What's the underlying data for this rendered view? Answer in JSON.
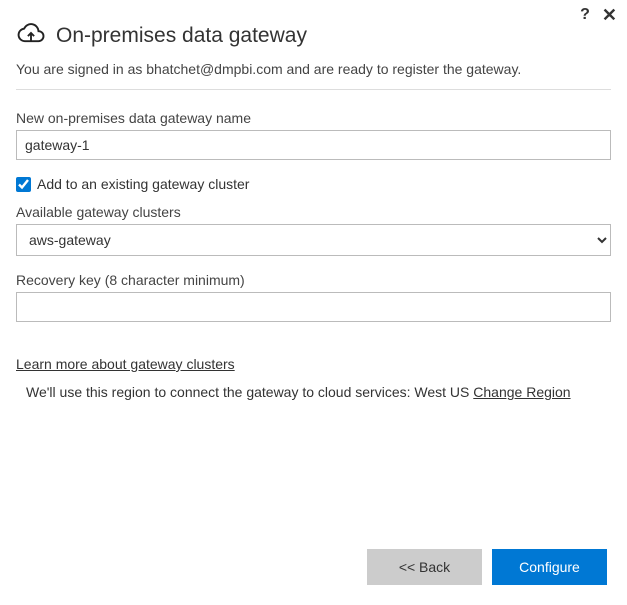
{
  "header": {
    "title": "On-premises data gateway",
    "subtitle_prefix": "You are signed in as ",
    "email": "bhatchet@dmpbi.com",
    "subtitle_suffix": " and are ready to register the gateway."
  },
  "form": {
    "gateway_name_label": "New on-premises data gateway name",
    "gateway_name_value": "gateway-1",
    "add_cluster_checkbox_label": "Add to an existing gateway cluster",
    "available_clusters_label": "Available gateway clusters",
    "available_clusters_value": "aws-gateway",
    "recovery_key_label": "Recovery key (8 character minimum)",
    "recovery_key_value": ""
  },
  "links": {
    "learn_more": "Learn more about gateway clusters",
    "region_text_prefix": "We'll use this region to connect the gateway to cloud services: ",
    "region_value": "West US ",
    "change_region": "Change Region"
  },
  "buttons": {
    "back": "<< Back",
    "configure": "Configure"
  }
}
